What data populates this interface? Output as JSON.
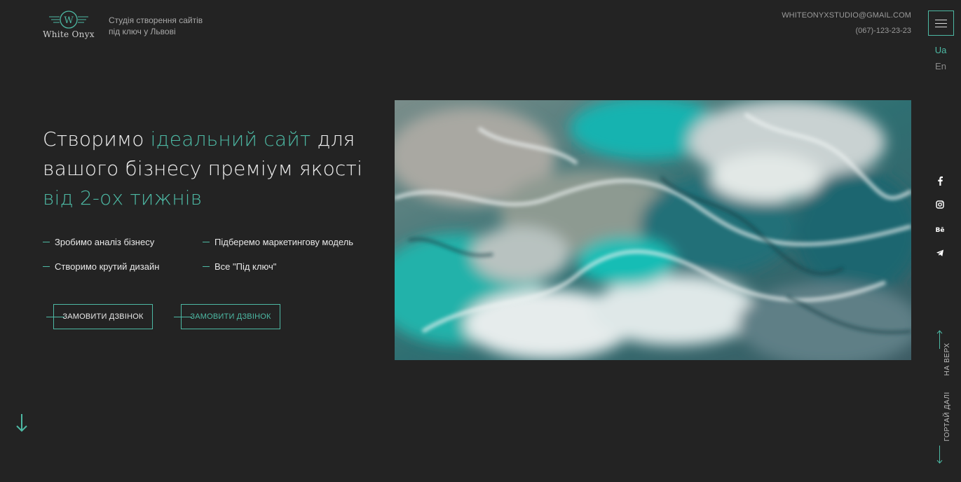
{
  "header": {
    "logo_name": "White Onyx",
    "tagline_line1": "Студія створення сайтів",
    "tagline_line2": "під ключ у Львові",
    "email": "WHITEONYXSTUDIO@GMAIL.COM",
    "phone": "(067)-123-23-23",
    "menu_icon": "hamburger-icon",
    "languages": {
      "active": "Ua",
      "other": "En"
    }
  },
  "hero": {
    "headline_part1": "Створимо ",
    "headline_accent1": "ідеальний сайт",
    "headline_part2": " для",
    "headline_line2": "вашого бізнесу преміум якості",
    "headline_accent2": "від 2-ох тижнів",
    "features": [
      "Зробимо аналіз бізнесу",
      "Підберемо маркетингову модель",
      "Створимо крутий дизайн",
      "Все \"Під ключ\""
    ],
    "button1": "ЗАМОВИТИ ДЗВІНОК",
    "button2": "ЗАМОВИТИ ДЗВІНОК",
    "image_icon": "marble-art-image"
  },
  "social": [
    "facebook-icon",
    "instagram-icon",
    "behance-icon",
    "telegram-icon"
  ],
  "side_nav": {
    "to_top": "НА ВЕРХ",
    "scroll_further": "ГОРТАЙ ДАЛІ"
  },
  "colors": {
    "background": "#232323",
    "accent": "#4db9a4",
    "text": "#e6e6e6"
  }
}
